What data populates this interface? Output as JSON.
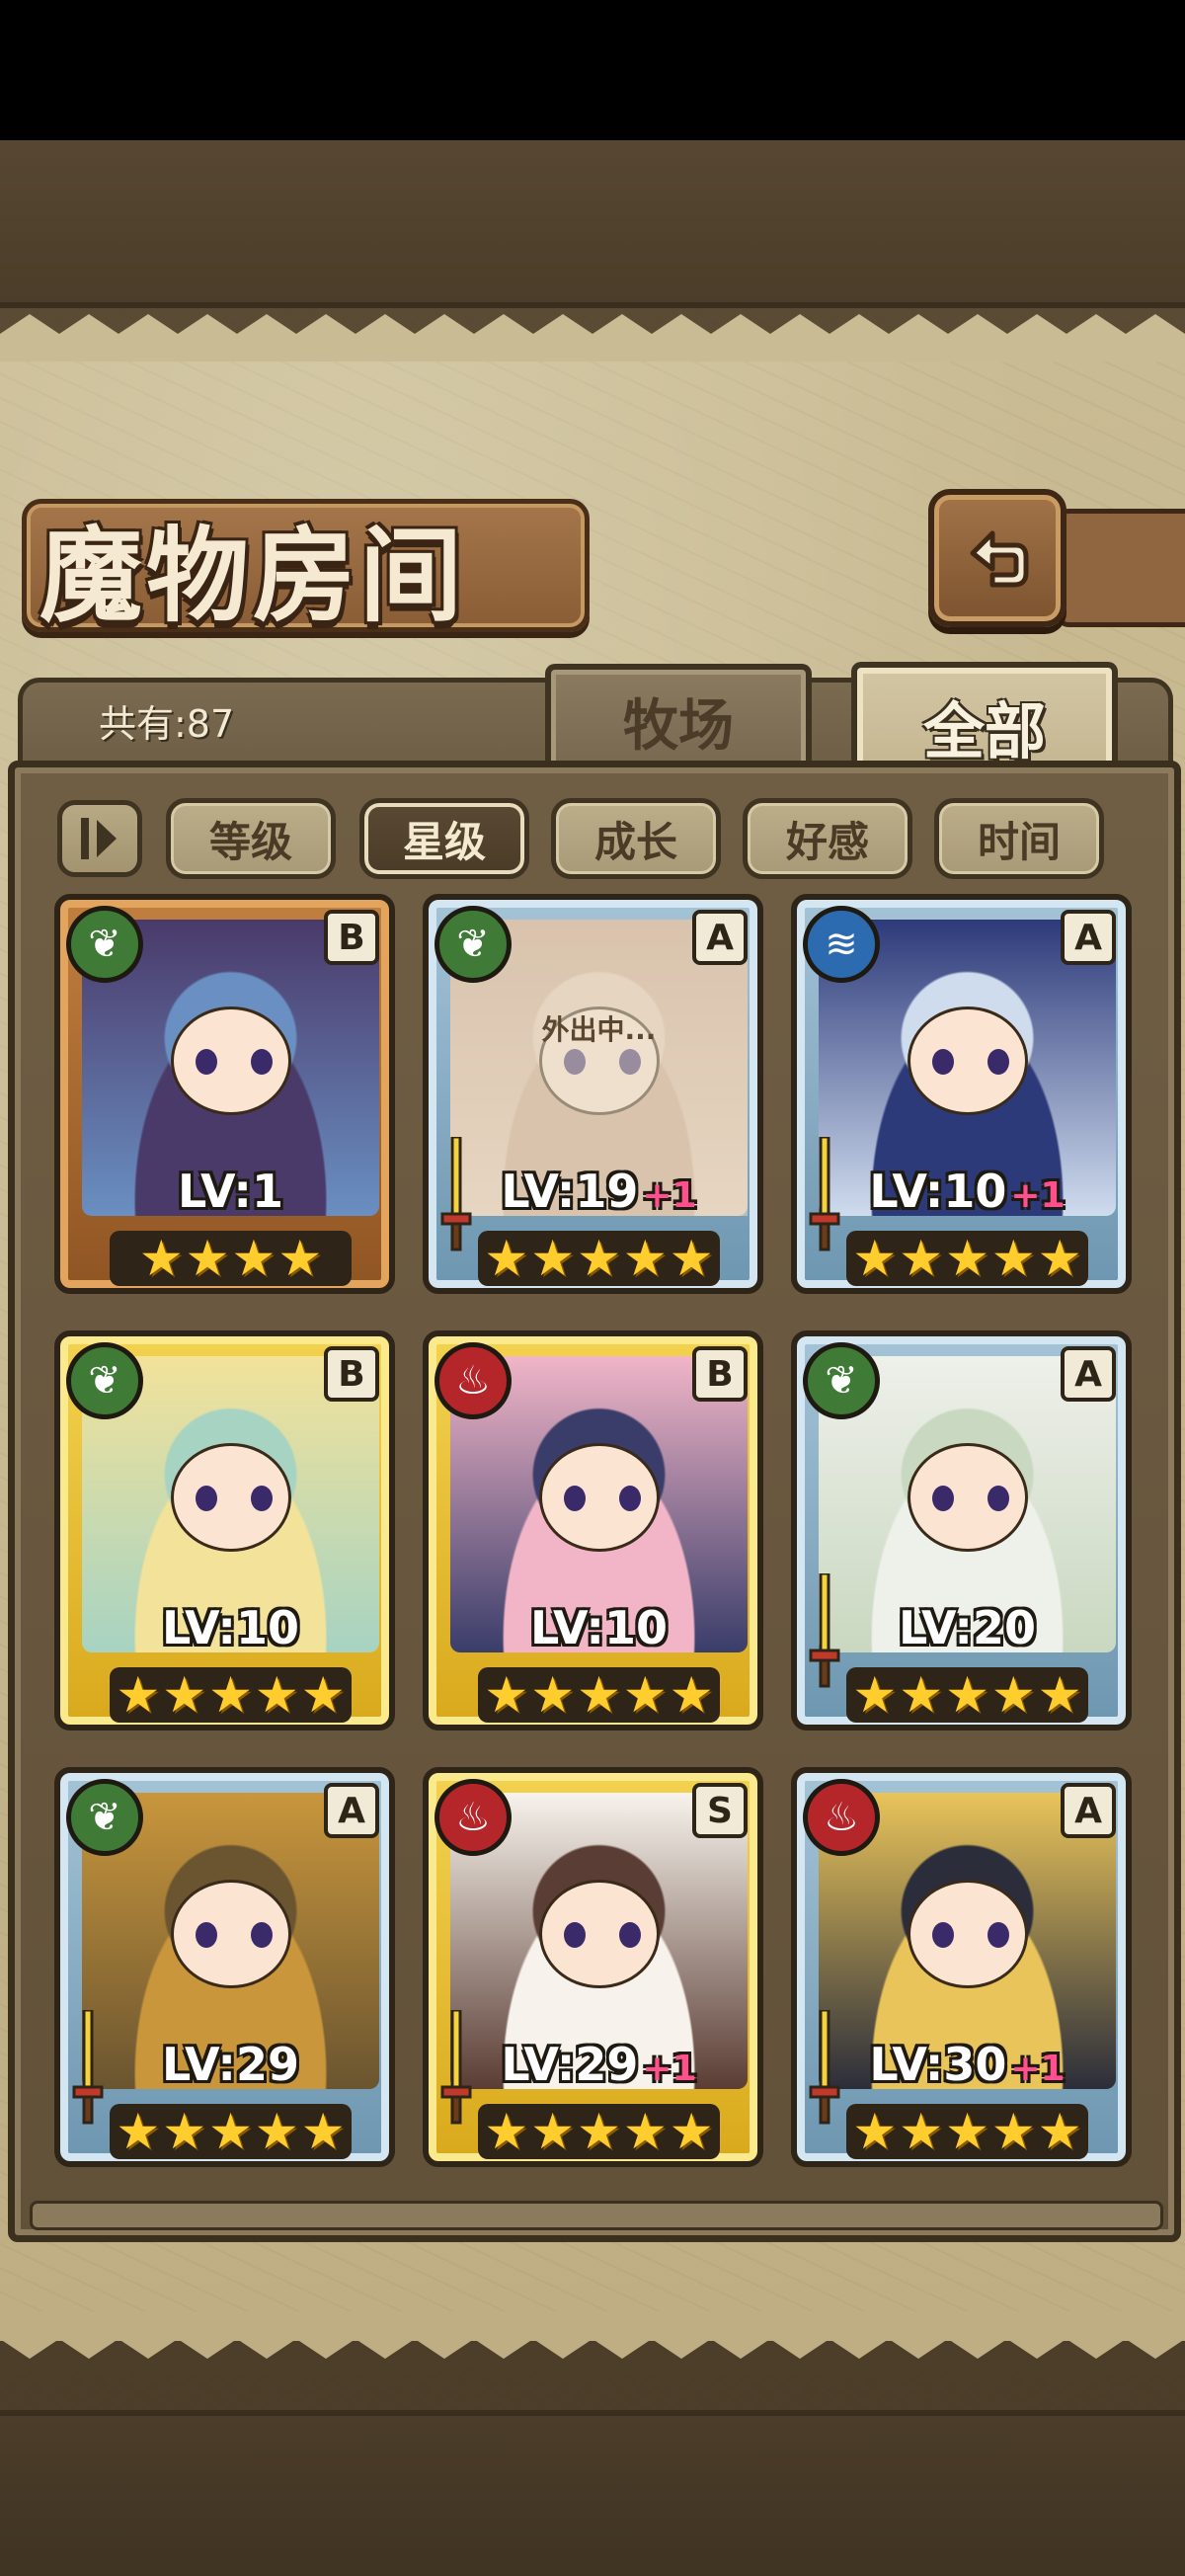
{
  "header": {
    "title": "魔物房间",
    "back_icon": "back-arrow-icon"
  },
  "summary": {
    "total_label": "共有:87"
  },
  "tabs": [
    {
      "label": "牧场",
      "active": false
    },
    {
      "label": "全部",
      "active": true
    }
  ],
  "filters": {
    "toggle_icon": "sort-order-icon",
    "buttons": [
      {
        "label": "等级",
        "active": false
      },
      {
        "label": "星级",
        "active": true
      },
      {
        "label": "成长",
        "active": false
      },
      {
        "label": "好感",
        "active": false
      },
      {
        "label": "时间",
        "active": false
      }
    ]
  },
  "monsters": [
    {
      "level": "LV:1",
      "plus": "",
      "rank": "B",
      "element": "leaf",
      "frame": "bronze",
      "stars": 4,
      "status": ""
    },
    {
      "level": "LV:19",
      "plus": "+1",
      "rank": "A",
      "element": "leaf",
      "frame": "silver",
      "stars": 5,
      "status": "外出中..."
    },
    {
      "level": "LV:10",
      "plus": "+1",
      "rank": "A",
      "element": "water",
      "frame": "silver",
      "stars": 5,
      "status": ""
    },
    {
      "level": "LV:10",
      "plus": "",
      "rank": "B",
      "element": "leaf",
      "frame": "gold",
      "stars": 5,
      "status": ""
    },
    {
      "level": "LV:10",
      "plus": "",
      "rank": "B",
      "element": "fire",
      "frame": "gold",
      "stars": 5,
      "status": ""
    },
    {
      "level": "LV:20",
      "plus": "",
      "rank": "A",
      "element": "leaf",
      "frame": "silver",
      "stars": 5,
      "status": ""
    },
    {
      "level": "LV:29",
      "plus": "",
      "rank": "A",
      "element": "leaf",
      "frame": "silver",
      "stars": 5,
      "status": ""
    },
    {
      "level": "LV:29",
      "plus": "+1",
      "rank": "S",
      "element": "fire",
      "frame": "gold",
      "stars": 5,
      "status": ""
    },
    {
      "level": "LV:30",
      "plus": "+1",
      "rank": "A",
      "element": "fire",
      "frame": "silver",
      "stars": 5,
      "status": ""
    }
  ],
  "colors": {
    "leaf": "#3f7a36",
    "fire": "#b5262a",
    "water": "#2c6bb0",
    "star": "#ffcd2e",
    "plus": "#ff4f8c"
  }
}
